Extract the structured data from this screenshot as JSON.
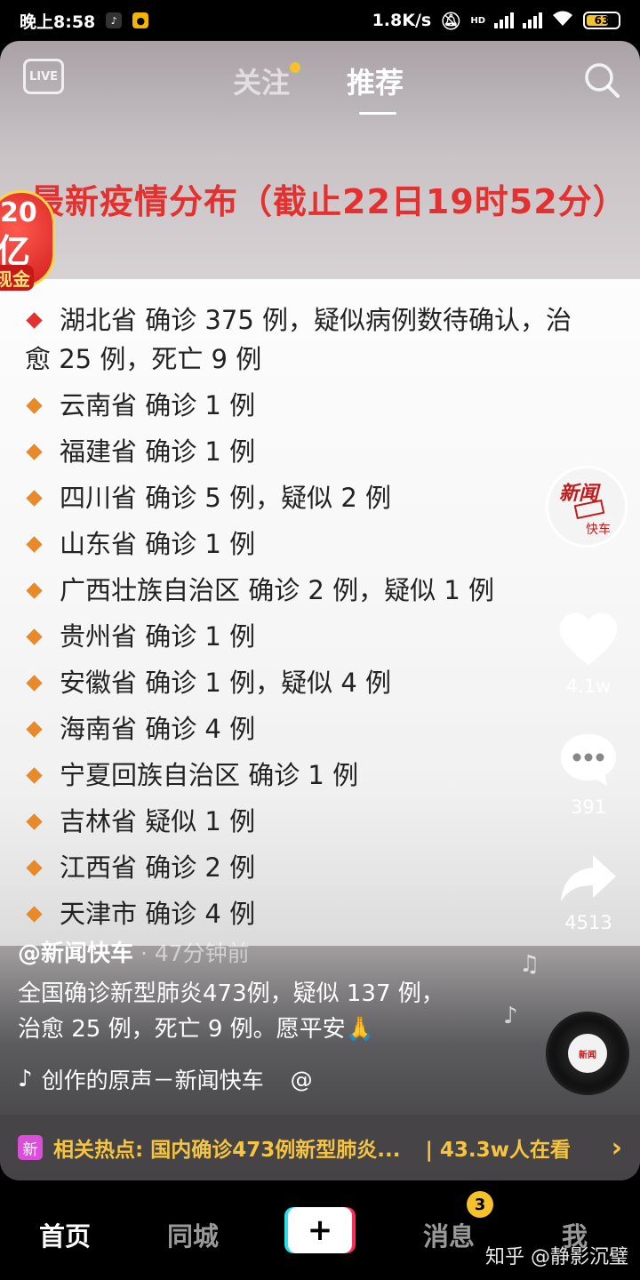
{
  "status_bar": {
    "time": "晚上8:58",
    "net_speed": "1.8K/s",
    "network_label": "HD",
    "battery": "63"
  },
  "top_nav": {
    "live_label": "LIVE",
    "tab_follow": "关注",
    "tab_recommend": "推荐"
  },
  "video": {
    "headline": "最新疫情分布（截止22日19时52分）",
    "promo": {
      "amount": "20",
      "unit": "亿",
      "label": "现金"
    },
    "entries": [
      {
        "text": "湖北省 确诊 375 例，疑似病例数待确认，治",
        "cont": "愈 25 例，死亡 9 例",
        "bullet": "red"
      },
      {
        "text": "云南省 确诊 1 例",
        "bullet": "orange"
      },
      {
        "text": "福建省 确诊 1 例",
        "bullet": "orange"
      },
      {
        "text": "四川省 确诊 5 例，疑似 2 例",
        "bullet": "orange"
      },
      {
        "text": "山东省 确诊 1 例",
        "bullet": "orange"
      },
      {
        "text": "广西壮族自治区 确诊 2 例，疑似 1 例",
        "bullet": "orange"
      },
      {
        "text": "贵州省 确诊 1 例",
        "bullet": "orange"
      },
      {
        "text": "安徽省 确诊 1 例，疑似 4 例",
        "bullet": "orange"
      },
      {
        "text": "海南省 确诊 4 例",
        "bullet": "orange"
      },
      {
        "text": "宁夏回族自治区 确诊 1 例",
        "bullet": "orange"
      },
      {
        "text": "吉林省 疑似 1 例",
        "bullet": "orange"
      },
      {
        "text": "江西省 确诊 2 例",
        "bullet": "orange"
      },
      {
        "text": "天津市 确诊 4 例",
        "bullet": "orange"
      }
    ]
  },
  "right_rail": {
    "avatar_title": "新闻",
    "avatar_sub": "快车",
    "likes": "4.1w",
    "comments": "391",
    "shares": "4513"
  },
  "post": {
    "author": "@新闻快车",
    "time": " · 47分钟前",
    "caption": "全国确诊新型肺炎473例，疑似 137 例，治愈 25 例，死亡 9 例。愿平安🙏",
    "music": "创作的原声－新闻快车",
    "music_at": "@"
  },
  "hot_bar": {
    "badge": "新",
    "text": "相关热点: 国内确诊473例新型肺炎...",
    "watching": "| 43.3w人在看",
    "arrow": "›"
  },
  "bottom_nav": {
    "home": "首页",
    "city": "同城",
    "plus": "+",
    "messages": "消息",
    "messages_badge": "3",
    "me": "我"
  },
  "watermark": "知乎 @静影沉璧",
  "colors": {
    "headline_red": "#e4312f",
    "bullet_orange": "#e8892a",
    "hot_yellow": "#f5c542",
    "badge_yellow": "#f6c12b"
  }
}
